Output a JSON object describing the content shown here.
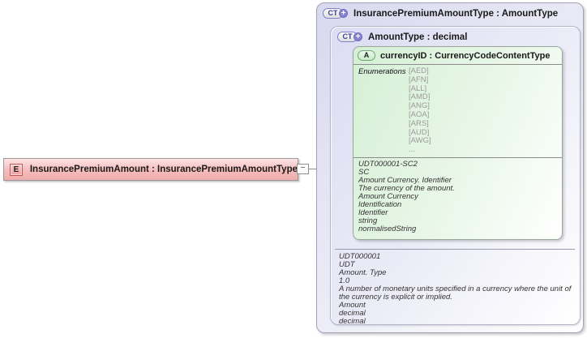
{
  "element": {
    "icon_letter": "E",
    "label": "InsurancePremiumAmount : InsurancePremiumAmountType",
    "toggle_symbol": "−"
  },
  "outer_type": {
    "icon_label": "CT",
    "icon_plus": "+",
    "title": "InsurancePremiumAmountType : AmountType"
  },
  "inner_type": {
    "icon_label": "CT",
    "icon_plus": "+",
    "title": "AmountType : decimal",
    "annotation": [
      "UDT000001",
      "UDT",
      "Amount. Type",
      "1.0",
      "A number of monetary units specified in a currency where the unit of the currency is explicit or implied.",
      "Amount",
      "decimal",
      "decimal"
    ]
  },
  "attribute": {
    "icon_letter": "A",
    "title": "currencyID : CurrencyCodeContentType",
    "enumerations_label": "Enumerations",
    "enumerations": [
      "[AED]",
      "[AFN]",
      "[ALL]",
      "[AMD]",
      "[ANG]",
      "[AOA]",
      "[ARS]",
      "[AUD]",
      "[AWG]",
      "..."
    ],
    "annotation": [
      "UDT000001-SC2",
      "SC",
      "Amount Currency. Identifier",
      "The currency of the amount.",
      "Amount Currency",
      "Identification",
      "Identifier",
      "string",
      "normalisedString"
    ]
  },
  "colors": {
    "element_fill": "#f5bcbc",
    "type_panel_fill": "#d8d8ef",
    "attribute_fill": "#d5efd5",
    "enum_value_text": "#9a9a9a",
    "annotation_text": "#333333"
  }
}
